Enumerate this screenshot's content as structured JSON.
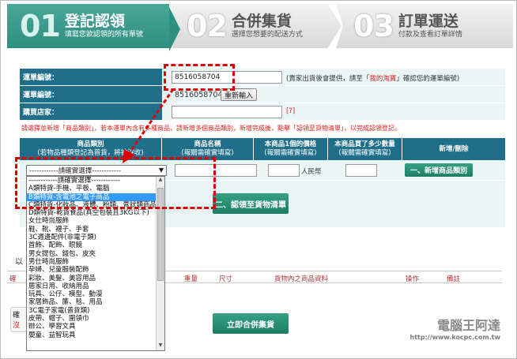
{
  "steps": [
    {
      "num": "01",
      "title": "登記認領",
      "sub": "填寫您欲認領的所有單號"
    },
    {
      "num": "02",
      "title": "合併集貨",
      "sub": "選擇您想要的配送方式"
    },
    {
      "num": "03",
      "title": "訂單運送",
      "sub": "付款及查看訂單詳情"
    }
  ],
  "form": {
    "tracking_label": "運單編號：",
    "tracking_value": "8516058704",
    "tracking_note_pre": "(賣家出貨後會提供，請至「",
    "tracking_note_link": "我的淘寶",
    "tracking_note_post": "」確認您的運單編號)",
    "tracking2_label": "運單編號：",
    "tracking2_value": "8516058704",
    "reenter_button": "重新輸入",
    "store_label": "購買店家：",
    "store_help": "[?]",
    "instruction": "請選擇並新增「商品類別」，若本運單內含有多種商品，請新增多個商品類別，新增完成後，點擊「認領至貨物清單」，以完成認領登記。"
  },
  "table_header": {
    "col1_a": "商品類別",
    "col1_b": "(若物品種類登記為普貨，將被沒收)",
    "col2_a": "商品名稱",
    "col2_b": "(報關需確實填寫)",
    "col3_a": "本商品1個的價格",
    "col3_b": "(報關需確實填寫)",
    "col4_a": "本商品買了多少數量",
    "col4_b": "(報關需確實填寫)",
    "col5": "新增/刪除"
  },
  "row": {
    "select_value": "------------請確實選擇------------",
    "currency": "人民幣",
    "add_button": "一、新增商品類別"
  },
  "claim_button": "二、認領至貨物清單",
  "dropdown_options": [
    "------------請確實選擇------------",
    "A類特貨-手機、平板、電腦",
    "B類特貨-含電池之電子商品",
    "C類特貨-化妝品、液體、粉類、膏狀類商品",
    "D類特貨-乾貨食品(真空包裝且3KG以下)",
    "女仕時尚服飾",
    "鞋、靴、襪子、手套",
    "3C週邊配件(非電子類)",
    "首飾、配飾、眼鏡",
    "男女提包、錢包、皮夾",
    "男仕時尚服飾",
    "孕婦、兒童服裝配飾",
    "彩妝、美髮、美容用品",
    "居家日用、收納用品",
    "玩具、公仔、模型、動漫",
    "家居飾品、簾、毯、用品",
    "3C電子家電(普貨類)",
    "皮帶、帽子、圍領巾",
    "辦公、學習文具",
    "嬰童、益智玩具"
  ],
  "dropdown_highlight": 2,
  "lower": {
    "prefix": "以",
    "cols": [
      "重量",
      "尺寸",
      "貨物內之商品資料",
      "操作",
      "備註"
    ],
    "left_a": "確",
    "left_b": "沒",
    "merge_button": "立即合併集貨"
  },
  "watermark": {
    "name": "電腦王阿達",
    "url": "http://www.kocpc.com.tw"
  }
}
